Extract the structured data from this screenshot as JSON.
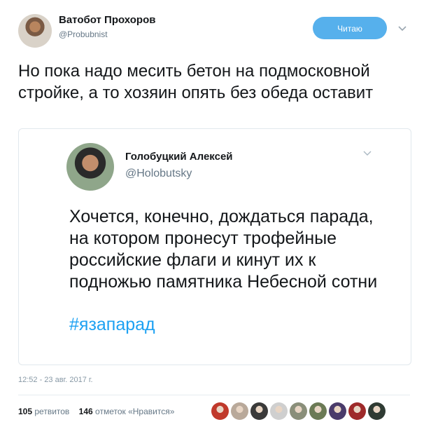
{
  "author": {
    "name": "Ватобот Прохоров",
    "handle": "@Probubnist",
    "follow_label": "Читаю"
  },
  "tweet": {
    "text": "Но пока надо месить бетон на подмосковной стройке, а то хозяин опять без обеда оставит"
  },
  "quoted": {
    "name": "Голобуцкий Алексей",
    "handle": "@Holobutsky",
    "text": "Хочется, конечно, дождаться парада, на котором пронесут трофейные российские флаги и кинут их к подножью памятника Небесной сотни",
    "hashtag": "#язапарад"
  },
  "timestamp": "12:52 - 23 авг. 2017 г.",
  "stats": {
    "retweets_count": "105",
    "retweets_label": "ретвитов",
    "likes_count": "146",
    "likes_label": "отметок «Нравится»"
  },
  "likers": [
    {
      "icon": "liker-avatar",
      "color": "#c0392b"
    },
    {
      "icon": "liker-avatar",
      "color": "#b9a99a"
    },
    {
      "icon": "liker-avatar",
      "color": "#3a3a3a"
    },
    {
      "icon": "liker-avatar",
      "color": "#cfcfcf"
    },
    {
      "icon": "liker-avatar",
      "color": "#8a8f7a"
    },
    {
      "icon": "liker-avatar",
      "color": "#6b7a55"
    },
    {
      "icon": "liker-avatar",
      "color": "#4a3b6b"
    },
    {
      "icon": "liker-avatar",
      "color": "#9e2a2a"
    },
    {
      "icon": "liker-avatar",
      "color": "#2f3b33"
    }
  ]
}
